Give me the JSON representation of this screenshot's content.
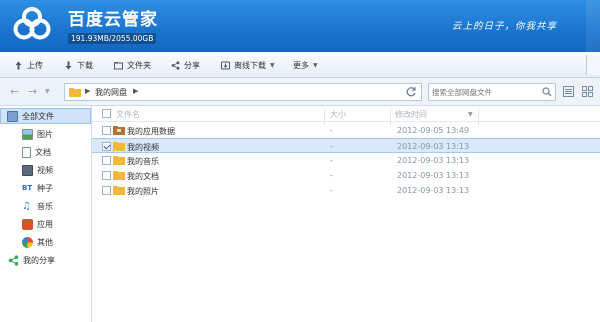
{
  "header": {
    "title": "百度云管家",
    "quota": "191.93MB/2055.00GB",
    "slogan": "云上的日子，你我共享"
  },
  "toolbar": [
    {
      "name": "upload",
      "label": "上传",
      "icon": "upload-icon",
      "dropdown": false
    },
    {
      "name": "download",
      "label": "下载",
      "icon": "download-icon",
      "dropdown": false
    },
    {
      "name": "new-folder",
      "label": "文件夹",
      "icon": "folder-icon",
      "dropdown": false
    },
    {
      "name": "share",
      "label": "分享",
      "icon": "share-icon",
      "dropdown": false
    },
    {
      "name": "offline-download",
      "label": "离线下载",
      "icon": "cloud-download-icon",
      "dropdown": true
    },
    {
      "name": "more",
      "label": "更多",
      "icon": null,
      "dropdown": true
    }
  ],
  "address": {
    "path": "我的网盘",
    "search_placeholder": "搜索全部网盘文件"
  },
  "sidebar": [
    {
      "name": "all-files",
      "label": "全部文件",
      "icon": "all-files-icon",
      "selected": true
    },
    {
      "name": "pictures",
      "label": "图片",
      "icon": "picture-icon",
      "selected": false
    },
    {
      "name": "documents",
      "label": "文档",
      "icon": "document-icon",
      "selected": false
    },
    {
      "name": "videos",
      "label": "视频",
      "icon": "video-icon",
      "selected": false
    },
    {
      "name": "torrents",
      "label": "种子",
      "icon": "bt-icon",
      "selected": false
    },
    {
      "name": "music",
      "label": "音乐",
      "icon": "music-icon",
      "selected": false
    },
    {
      "name": "apps",
      "label": "应用",
      "icon": "app-icon",
      "selected": false
    },
    {
      "name": "other",
      "label": "其他",
      "icon": "other-icon",
      "selected": false
    },
    {
      "name": "my-share",
      "label": "我的分享",
      "icon": "share-icon",
      "selected": false
    }
  ],
  "columns": {
    "name": "文件名",
    "size": "大小",
    "modified": "修改时间"
  },
  "files": [
    {
      "name": "我的应用数据",
      "size": "-",
      "modified": "2012-09-05 13:49",
      "icon": "app-folder-icon",
      "selected": false
    },
    {
      "name": "我的视频",
      "size": "-",
      "modified": "2012-09-03 13:13",
      "icon": "folder-icon",
      "selected": true
    },
    {
      "name": "我的音乐",
      "size": "-",
      "modified": "2012-09-03 13:13",
      "icon": "folder-icon",
      "selected": false
    },
    {
      "name": "我的文档",
      "size": "-",
      "modified": "2012-09-03 13:13",
      "icon": "folder-icon",
      "selected": false
    },
    {
      "name": "我的照片",
      "size": "-",
      "modified": "2012-09-03 13:13",
      "icon": "folder-icon",
      "selected": false
    }
  ],
  "colors": {
    "header": "#1a74cf",
    "selection": "#d9e9fb",
    "folder": "#f2b83a"
  }
}
